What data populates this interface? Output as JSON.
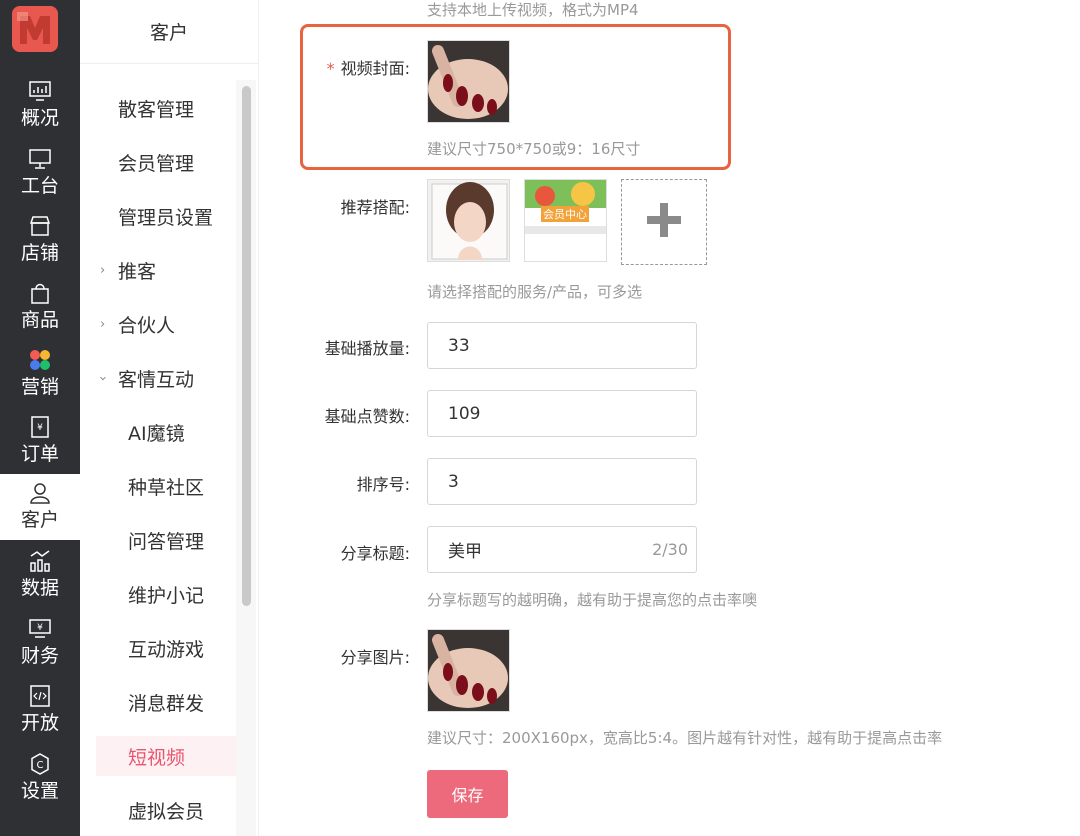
{
  "nav": {
    "items": [
      {
        "label": "概况",
        "icon": "dashboard-icon"
      },
      {
        "label": "工台",
        "icon": "monitor-icon"
      },
      {
        "label": "店铺",
        "icon": "store-icon"
      },
      {
        "label": "商品",
        "icon": "bag-icon"
      },
      {
        "label": "营销",
        "icon": "marketing-flower-icon"
      },
      {
        "label": "订单",
        "icon": "order-icon"
      },
      {
        "label": "客户",
        "icon": "user-icon"
      },
      {
        "label": "数据",
        "icon": "chart-icon"
      },
      {
        "label": "财务",
        "icon": "finance-icon"
      },
      {
        "label": "开放",
        "icon": "code-icon"
      },
      {
        "label": "设置",
        "icon": "settings-icon"
      }
    ],
    "active": "客户"
  },
  "sidebar": {
    "title": "客户",
    "items": [
      {
        "label": "散客管理",
        "level": 1
      },
      {
        "label": "会员管理",
        "level": 1
      },
      {
        "label": "管理员设置",
        "level": 1
      },
      {
        "label": "推客",
        "level": 1,
        "chevron": "right"
      },
      {
        "label": "合伙人",
        "level": 1,
        "chevron": "right"
      },
      {
        "label": "客情互动",
        "level": 1,
        "chevron": "down"
      },
      {
        "label": "AI魔镜",
        "level": 2
      },
      {
        "label": "种草社区",
        "level": 2
      },
      {
        "label": "问答管理",
        "level": 2
      },
      {
        "label": "维护小记",
        "level": 2
      },
      {
        "label": "互动游戏",
        "level": 2
      },
      {
        "label": "消息群发",
        "level": 2
      },
      {
        "label": "短视频",
        "level": 2,
        "active": true
      },
      {
        "label": "虚拟会员",
        "level": 2
      }
    ]
  },
  "form": {
    "video_hint": "支持本地上传视频，格式为MP4",
    "cover_label": "视频封面:",
    "cover_required": "*",
    "cover_hint": "建议尺寸750*750或9：16尺寸",
    "recommend_label": "推荐搭配:",
    "recommend_hint": "请选择搭配的服务/产品，可多选",
    "recommend_item_2_text": "会员中心",
    "base_plays_label": "基础播放量:",
    "base_plays_value": "33",
    "base_likes_label": "基础点赞数:",
    "base_likes_value": "109",
    "sort_label": "排序号:",
    "sort_value": "3",
    "share_title_label": "分享标题:",
    "share_title_value": "美甲",
    "share_title_counter": "2/30",
    "share_title_hint": "分享标题写的越明确，越有助于提高您的点击率噢",
    "share_image_label": "分享图片:",
    "share_image_hint": "建议尺寸：200X160px，宽高比5:4。图片越有针对性，越有助于提高点击率",
    "save_label": "保存"
  },
  "colors": {
    "sidebar_dark": "#2f3033",
    "accent_pink": "#e8566e",
    "save_button": "#ec6a7b",
    "highlight_border": "#e8643f",
    "logo": "#e8584e"
  }
}
